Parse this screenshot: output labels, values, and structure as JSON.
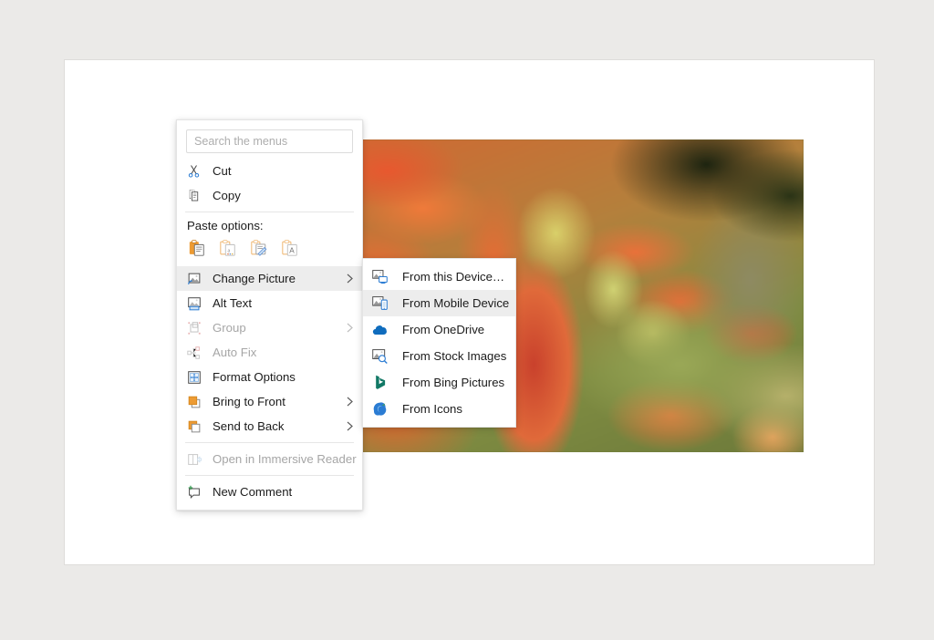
{
  "app": {
    "background_color": "#ebeae8",
    "page_color": "#ffffff"
  },
  "picture": {
    "name": "succulent-plant-photo",
    "description": "Close-up photo of a succulent with red and orange tipped leaves and a blurred green background"
  },
  "context_menu": {
    "search": {
      "placeholder": "Search the menus",
      "value": ""
    },
    "items": [
      {
        "id": "cut",
        "label": "Cut",
        "icon": "scissors-icon",
        "disabled": false,
        "submenu": false
      },
      {
        "id": "copy",
        "label": "Copy",
        "icon": "copy-icon",
        "disabled": false,
        "submenu": false
      }
    ],
    "paste_options": {
      "label": "Paste options:",
      "buttons": [
        {
          "id": "keep-source-formatting",
          "icon": "paste-keep-source-formatting-icon"
        },
        {
          "id": "picture",
          "icon": "paste-picture-icon"
        },
        {
          "id": "merge-formatting",
          "icon": "paste-merge-formatting-icon"
        },
        {
          "id": "keep-text-only",
          "icon": "paste-keep-text-only-icon"
        }
      ]
    },
    "actions": [
      {
        "id": "change-picture",
        "label": "Change Picture",
        "icon": "change-picture-icon",
        "disabled": false,
        "submenu": true,
        "highlighted": true
      },
      {
        "id": "alt-text",
        "label": "Alt Text",
        "icon": "alt-text-icon",
        "disabled": false,
        "submenu": false,
        "highlighted": false
      },
      {
        "id": "group",
        "label": "Group",
        "icon": "group-icon",
        "disabled": true,
        "submenu": true,
        "highlighted": false
      },
      {
        "id": "auto-fix",
        "label": "Auto Fix",
        "icon": "auto-fix-icon",
        "disabled": true,
        "submenu": false,
        "highlighted": false
      },
      {
        "id": "format-options",
        "label": "Format Options",
        "icon": "format-options-icon",
        "disabled": false,
        "submenu": false,
        "highlighted": false
      },
      {
        "id": "bring-to-front",
        "label": "Bring to Front",
        "icon": "bring-to-front-icon",
        "disabled": false,
        "submenu": true,
        "highlighted": false
      },
      {
        "id": "send-to-back",
        "label": "Send to Back",
        "icon": "send-to-back-icon",
        "disabled": false,
        "submenu": true,
        "highlighted": false
      }
    ],
    "footer_items": [
      {
        "id": "open-in-immersive-reader",
        "label": "Open in Immersive Reader",
        "icon": "immersive-reader-icon",
        "disabled": true
      },
      {
        "id": "new-comment",
        "label": "New Comment",
        "icon": "new-comment-icon",
        "disabled": false
      }
    ]
  },
  "submenu": {
    "title": "Change Picture",
    "items": [
      {
        "id": "from-this-device",
        "label": "From this Device…",
        "icon": "from-this-device-icon",
        "highlighted": false
      },
      {
        "id": "from-mobile-device",
        "label": "From Mobile Device",
        "icon": "from-mobile-device-icon",
        "highlighted": true
      },
      {
        "id": "from-onedrive",
        "label": "From OneDrive",
        "icon": "onedrive-cloud-icon",
        "highlighted": false
      },
      {
        "id": "from-stock-images",
        "label": "From Stock Images",
        "icon": "stock-images-icon",
        "highlighted": false
      },
      {
        "id": "from-bing-pictures",
        "label": "From Bing Pictures",
        "icon": "bing-icon",
        "highlighted": false
      },
      {
        "id": "from-icons",
        "label": "From Icons",
        "icon": "icons-icon",
        "highlighted": false
      }
    ]
  },
  "colors": {
    "highlight": "#ededed",
    "accent_blue": "#0f6cbd",
    "accent_orange": "#ed9b33",
    "disabled_text": "#a6a6a6",
    "text": "#1b1b1b"
  }
}
